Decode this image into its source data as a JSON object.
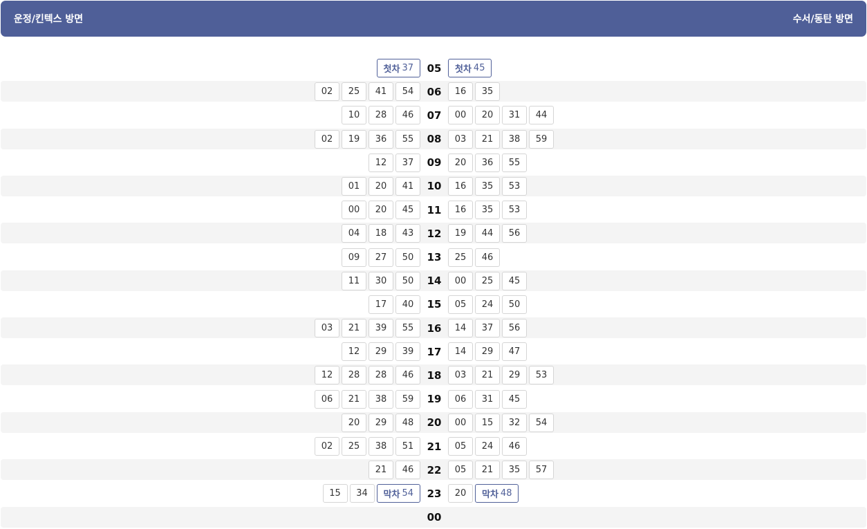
{
  "header": {
    "left_direction": "운정/킨텍스 방면",
    "right_direction": "수서/동탄 방면"
  },
  "rows": [
    {
      "hour": "05",
      "left": [
        {
          "tag": "첫차",
          "min": "37"
        }
      ],
      "right": [
        {
          "tag": "첫차",
          "min": "45"
        }
      ]
    },
    {
      "hour": "06",
      "left": [
        {
          "min": "02"
        },
        {
          "min": "25"
        },
        {
          "min": "41"
        },
        {
          "min": "54"
        }
      ],
      "right": [
        {
          "min": "16"
        },
        {
          "min": "35"
        }
      ]
    },
    {
      "hour": "07",
      "left": [
        {
          "min": "10"
        },
        {
          "min": "28"
        },
        {
          "min": "46"
        }
      ],
      "right": [
        {
          "min": "00"
        },
        {
          "min": "20"
        },
        {
          "min": "31"
        },
        {
          "min": "44"
        }
      ]
    },
    {
      "hour": "08",
      "left": [
        {
          "min": "02"
        },
        {
          "min": "19"
        },
        {
          "min": "36"
        },
        {
          "min": "55"
        }
      ],
      "right": [
        {
          "min": "03"
        },
        {
          "min": "21"
        },
        {
          "min": "38"
        },
        {
          "min": "59"
        }
      ]
    },
    {
      "hour": "09",
      "left": [
        {
          "min": "12"
        },
        {
          "min": "37"
        }
      ],
      "right": [
        {
          "min": "20"
        },
        {
          "min": "36"
        },
        {
          "min": "55"
        }
      ]
    },
    {
      "hour": "10",
      "left": [
        {
          "min": "01"
        },
        {
          "min": "20"
        },
        {
          "min": "41"
        }
      ],
      "right": [
        {
          "min": "16"
        },
        {
          "min": "35"
        },
        {
          "min": "53"
        }
      ]
    },
    {
      "hour": "11",
      "left": [
        {
          "min": "00"
        },
        {
          "min": "20"
        },
        {
          "min": "45"
        }
      ],
      "right": [
        {
          "min": "16"
        },
        {
          "min": "35"
        },
        {
          "min": "53"
        }
      ]
    },
    {
      "hour": "12",
      "left": [
        {
          "min": "04"
        },
        {
          "min": "18"
        },
        {
          "min": "43"
        }
      ],
      "right": [
        {
          "min": "19"
        },
        {
          "min": "44"
        },
        {
          "min": "56"
        }
      ]
    },
    {
      "hour": "13",
      "left": [
        {
          "min": "09"
        },
        {
          "min": "27"
        },
        {
          "min": "50"
        }
      ],
      "right": [
        {
          "min": "25"
        },
        {
          "min": "46"
        }
      ]
    },
    {
      "hour": "14",
      "left": [
        {
          "min": "11"
        },
        {
          "min": "30"
        },
        {
          "min": "50"
        }
      ],
      "right": [
        {
          "min": "00"
        },
        {
          "min": "25"
        },
        {
          "min": "45"
        }
      ]
    },
    {
      "hour": "15",
      "left": [
        {
          "min": "17"
        },
        {
          "min": "40"
        }
      ],
      "right": [
        {
          "min": "05"
        },
        {
          "min": "24"
        },
        {
          "min": "50"
        }
      ]
    },
    {
      "hour": "16",
      "left": [
        {
          "min": "03"
        },
        {
          "min": "21"
        },
        {
          "min": "39"
        },
        {
          "min": "55"
        }
      ],
      "right": [
        {
          "min": "14"
        },
        {
          "min": "37"
        },
        {
          "min": "56"
        }
      ]
    },
    {
      "hour": "17",
      "left": [
        {
          "min": "12"
        },
        {
          "min": "29"
        },
        {
          "min": "39"
        }
      ],
      "right": [
        {
          "min": "14"
        },
        {
          "min": "29"
        },
        {
          "min": "47"
        }
      ]
    },
    {
      "hour": "18",
      "left": [
        {
          "min": "12"
        },
        {
          "min": "28"
        },
        {
          "min": "28"
        },
        {
          "min": "46"
        }
      ],
      "right": [
        {
          "min": "03"
        },
        {
          "min": "21"
        },
        {
          "min": "29"
        },
        {
          "min": "53"
        }
      ]
    },
    {
      "hour": "19",
      "left": [
        {
          "min": "06"
        },
        {
          "min": "21"
        },
        {
          "min": "38"
        },
        {
          "min": "59"
        }
      ],
      "right": [
        {
          "min": "06"
        },
        {
          "min": "31"
        },
        {
          "min": "45"
        }
      ]
    },
    {
      "hour": "20",
      "left": [
        {
          "min": "20"
        },
        {
          "min": "29"
        },
        {
          "min": "48"
        }
      ],
      "right": [
        {
          "min": "00"
        },
        {
          "min": "15"
        },
        {
          "min": "32"
        },
        {
          "min": "54"
        }
      ]
    },
    {
      "hour": "21",
      "left": [
        {
          "min": "02"
        },
        {
          "min": "25"
        },
        {
          "min": "38"
        },
        {
          "min": "51"
        }
      ],
      "right": [
        {
          "min": "05"
        },
        {
          "min": "24"
        },
        {
          "min": "46"
        }
      ]
    },
    {
      "hour": "22",
      "left": [
        {
          "min": "21"
        },
        {
          "min": "46"
        }
      ],
      "right": [
        {
          "min": "05"
        },
        {
          "min": "21"
        },
        {
          "min": "35"
        },
        {
          "min": "57"
        }
      ]
    },
    {
      "hour": "23",
      "left": [
        {
          "min": "15"
        },
        {
          "min": "34"
        },
        {
          "tag": "막차",
          "min": "54"
        }
      ],
      "right": [
        {
          "min": "20"
        },
        {
          "tag": "막차",
          "min": "48"
        }
      ]
    },
    {
      "hour": "00",
      "left": [],
      "right": []
    }
  ],
  "colors": {
    "header_bg": "#4f5f98",
    "stripe_bg": "#f4f4f4",
    "special_border": "#4f5f98"
  }
}
